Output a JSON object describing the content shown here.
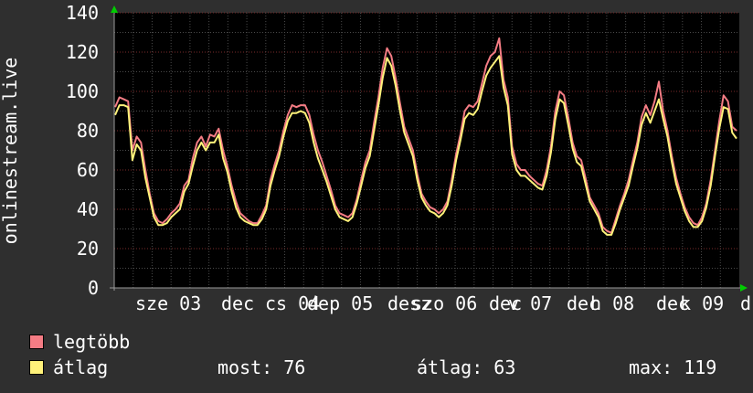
{
  "chart_data": {
    "type": "line",
    "ylabel": "onlinestream.live",
    "ylim": [
      0,
      140
    ],
    "yticks": [
      0,
      20,
      40,
      60,
      80,
      100,
      120,
      140
    ],
    "x_tick_labels": [
      "sze 03",
      "dec",
      "cs 04",
      "dep 05",
      "desz",
      "szo 06",
      "dec",
      "v 07",
      "dec",
      "h 08",
      "dec",
      "k 09",
      "d"
    ],
    "series": [
      {
        "name": "legtöbb",
        "color": "#f47c84",
        "values": [
          92,
          97,
          96,
          95,
          70,
          77,
          74,
          60,
          48,
          38,
          34,
          33,
          35,
          38,
          40,
          43,
          52,
          55,
          66,
          74,
          77,
          72,
          78,
          77,
          81,
          70,
          62,
          52,
          44,
          38,
          36,
          34,
          33,
          33,
          37,
          42,
          55,
          63,
          70,
          80,
          88,
          93,
          92,
          93,
          93,
          88,
          78,
          70,
          64,
          57,
          50,
          42,
          38,
          37,
          36,
          38,
          45,
          55,
          64,
          70,
          84,
          97,
          112,
          122,
          118,
          107,
          94,
          82,
          76,
          70,
          58,
          48,
          44,
          41,
          40,
          38,
          40,
          44,
          55,
          68,
          78,
          90,
          93,
          92,
          95,
          104,
          113,
          118,
          120,
          127,
          106,
          97,
          72,
          63,
          60,
          60,
          57,
          55,
          53,
          52,
          60,
          72,
          90,
          100,
          98,
          87,
          74,
          67,
          65,
          56,
          46,
          42,
          38,
          31,
          29,
          28,
          35,
          42,
          48,
          55,
          65,
          74,
          87,
          93,
          88,
          95,
          105,
          90,
          80,
          67,
          56,
          48,
          41,
          36,
          33,
          32,
          36,
          43,
          55,
          70,
          85,
          98,
          95,
          82,
          80
        ]
      },
      {
        "name": "átlag",
        "color": "#fff27a",
        "values": [
          88,
          93,
          93,
          92,
          65,
          73,
          70,
          56,
          46,
          36,
          32,
          32,
          33,
          36,
          38,
          40,
          49,
          53,
          62,
          70,
          74,
          70,
          74,
          74,
          78,
          66,
          59,
          49,
          41,
          36,
          34,
          33,
          32,
          32,
          35,
          40,
          52,
          60,
          67,
          77,
          85,
          89,
          89,
          90,
          89,
          84,
          74,
          66,
          60,
          54,
          47,
          40,
          36,
          35,
          34,
          36,
          43,
          52,
          61,
          67,
          80,
          93,
          107,
          117,
          113,
          103,
          90,
          79,
          73,
          67,
          55,
          46,
          42,
          39,
          38,
          36,
          38,
          42,
          52,
          65,
          75,
          86,
          89,
          88,
          91,
          100,
          108,
          112,
          115,
          118,
          102,
          93,
          68,
          60,
          57,
          57,
          55,
          53,
          51,
          50,
          57,
          69,
          86,
          96,
          94,
          83,
          71,
          64,
          62,
          53,
          44,
          40,
          36,
          29,
          27,
          27,
          33,
          40,
          46,
          52,
          62,
          71,
          83,
          89,
          84,
          90,
          96,
          86,
          77,
          64,
          53,
          46,
          39,
          34,
          31,
          31,
          34,
          41,
          52,
          67,
          81,
          92,
          91,
          79,
          76
        ]
      }
    ],
    "grid": true
  },
  "legend": {
    "items": [
      {
        "label": "legtöbb",
        "color": "#f47c84"
      },
      {
        "label": "átlag",
        "color": "#fff27a"
      }
    ]
  },
  "stats": {
    "most": "most: 76",
    "atlag": "átlag: 63",
    "max": "max: 119"
  }
}
